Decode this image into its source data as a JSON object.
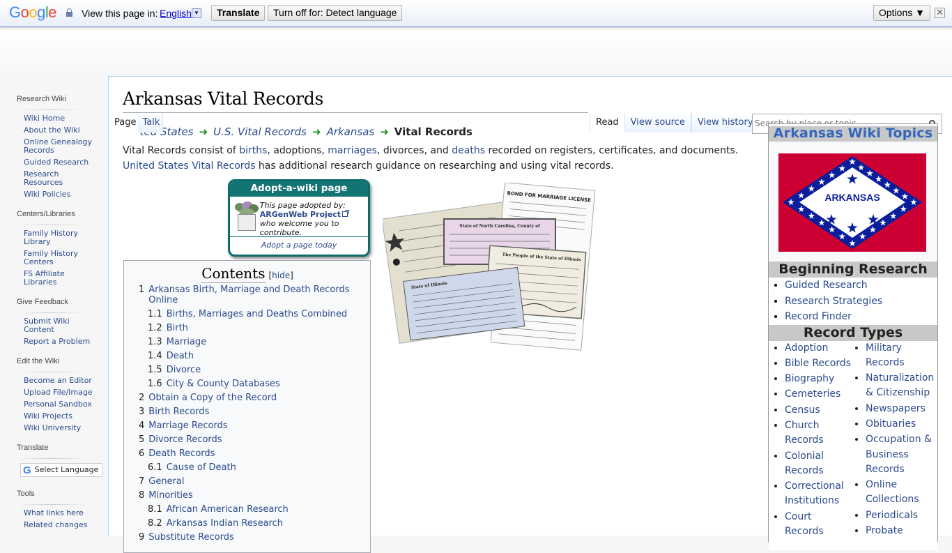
{
  "translate_bar": {
    "logo": [
      "G",
      "o",
      "o",
      "g",
      "l",
      "e"
    ],
    "view_label": "View this page in:",
    "language": "English",
    "translate_button": "Translate",
    "turn_off_button": "Turn off for: Detect language",
    "options_button": "Options ▼",
    "close_glyph": "✕"
  },
  "sidebar": {
    "sections": [
      {
        "title": "Research Wiki",
        "items": [
          "Wiki Home",
          "About the Wiki",
          "Online Genealogy Records",
          "Guided Research",
          "Research Resources",
          "Wiki Policies"
        ]
      },
      {
        "title": "Centers/Libraries",
        "items": [
          "Family History Library",
          "Family History Centers",
          "FS Affiliate Libraries"
        ]
      },
      {
        "title": "Give Feedback",
        "items": [
          "Submit Wiki Content",
          "Report a Problem"
        ]
      },
      {
        "title": "Edit the Wiki",
        "items": [
          "Become an Editor",
          "Upload File/Image",
          "Personal Sandbox",
          "Wiki Projects",
          "Wiki University"
        ]
      },
      {
        "title": "Translate",
        "select_language": "Select Language"
      },
      {
        "title": "Tools",
        "items": [
          "What links here",
          "Related changes"
        ]
      }
    ]
  },
  "page": {
    "title": "Arkansas Vital Records",
    "tabs_left": [
      "Page",
      "Talk"
    ],
    "tabs_right": [
      "Read",
      "View source",
      "View history"
    ],
    "search_placeholder": "Search by place or topic",
    "breadcrumb": [
      "United States",
      "U.S. Vital Records",
      "Arkansas",
      "Vital Records"
    ],
    "intro": {
      "p1_a": "Vital Records consist of ",
      "births": "births",
      "p1_b": ", adoptions, ",
      "marriages": "marriages",
      "p1_c": ", divorces, and ",
      "deaths": "deaths",
      "p1_d": " recorded on registers, certificates, and documents.",
      "us_link": "United States Vital Records",
      "p2": " has additional research guidance on researching and using vital records."
    }
  },
  "adopt_box": {
    "title": "Adopt-a-wiki page",
    "adopted_by": "This page adopted by:",
    "adopter": "ARGenWeb Project",
    "welcome": "who welcome you to contribute.",
    "footer_link": "Adopt a page today"
  },
  "toc": {
    "title": "Contents",
    "hide_open": "[",
    "hide": "hide",
    "hide_close": "]",
    "items": [
      {
        "num": "1",
        "label": "Arkansas Birth, Marriage and Death Records Online",
        "level": 1
      },
      {
        "num": "1.1",
        "label": "Births, Marriages and Deaths Combined",
        "level": 2
      },
      {
        "num": "1.2",
        "label": "Birth",
        "level": 2
      },
      {
        "num": "1.3",
        "label": "Marriage",
        "level": 2
      },
      {
        "num": "1.4",
        "label": "Death",
        "level": 2
      },
      {
        "num": "1.5",
        "label": "Divorce",
        "level": 2
      },
      {
        "num": "1.6",
        "label": "City & County Databases",
        "level": 2
      },
      {
        "num": "2",
        "label": "Obtain a Copy of the Record",
        "level": 1
      },
      {
        "num": "3",
        "label": "Birth Records",
        "level": 1
      },
      {
        "num": "4",
        "label": "Marriage Records",
        "level": 1
      },
      {
        "num": "5",
        "label": "Divorce Records",
        "level": 1
      },
      {
        "num": "6",
        "label": "Death Records",
        "level": 1
      },
      {
        "num": "6.1",
        "label": "Cause of Death",
        "level": 2
      },
      {
        "num": "7",
        "label": "General",
        "level": 1
      },
      {
        "num": "8",
        "label": "Minorities",
        "level": 1
      },
      {
        "num": "8.1",
        "label": "African American Research",
        "level": 2
      },
      {
        "num": "8.2",
        "label": "Arkansas Indian Research",
        "level": 2
      },
      {
        "num": "9",
        "label": "Substitute Records",
        "level": 1
      }
    ]
  },
  "infobox": {
    "title": "Arkansas Wiki Topics",
    "flag_text": "ARKANSAS",
    "flag_colors": {
      "red": "#cc0033",
      "blue": "#0a1e9c",
      "white": "#ffffff"
    },
    "beginning_research": {
      "title": "Beginning Research",
      "items": [
        "Guided Research",
        "Research Strategies",
        "Record Finder"
      ]
    },
    "record_types": {
      "title": "Record Types",
      "col1": [
        "Adoption",
        "Bible Records",
        "Biography",
        "Cemeteries",
        "Census",
        "Church Records",
        "Colonial Records",
        "Correctional Institutions",
        "Court Records"
      ],
      "col2": [
        "Military Records",
        "Naturalization & Citizenship",
        "Newspapers",
        "Obituaries",
        "Occupation & Business Records",
        "Online Collections",
        "Periodicals",
        "Probate"
      ]
    }
  }
}
